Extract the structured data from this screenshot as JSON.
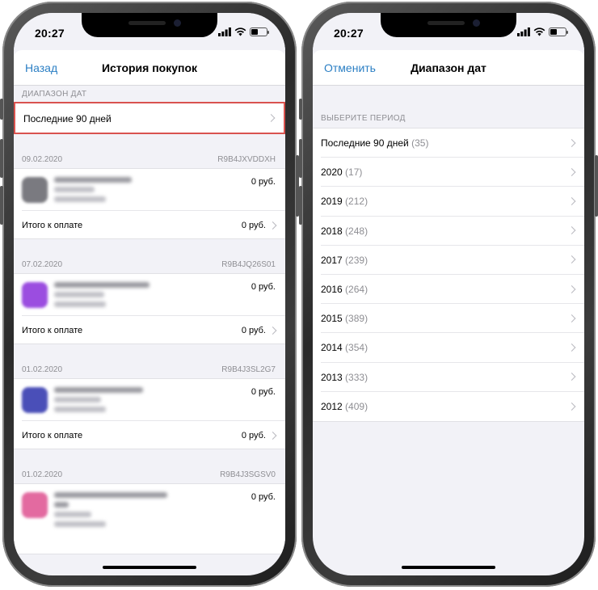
{
  "status": {
    "time": "20:27"
  },
  "left_screen": {
    "nav": {
      "back_label": "Назад",
      "title": "История покупок"
    },
    "range_section_header": "ДИАПАЗОН ДАТ",
    "range_value": "Последние 90 дней",
    "total_label": "Итого к оплате",
    "purchases": [
      {
        "date": "09.02.2020",
        "order_id": "R9B4JXVDDXH",
        "price": "0 руб.",
        "total": "0 руб.",
        "thumb_color": "#7a7a80"
      },
      {
        "date": "07.02.2020",
        "order_id": "R9B4JQ26S01",
        "price": "0 руб.",
        "total": "0 руб.",
        "thumb_color": "#9b4de0"
      },
      {
        "date": "01.02.2020",
        "order_id": "R9B4J3SL2G7",
        "price": "0 руб.",
        "total": "0 руб.",
        "thumb_color": "#4a4fb8"
      },
      {
        "date": "01.02.2020",
        "order_id": "R9B4J3SGSV0",
        "price": "0 руб.",
        "total": "",
        "thumb_color": "#e36aa0"
      }
    ]
  },
  "right_screen": {
    "nav": {
      "cancel_label": "Отменить",
      "title": "Диапазон дат"
    },
    "period_header": "ВЫБЕРИТЕ ПЕРИОД",
    "periods": [
      {
        "label": "Последние 90 дней",
        "count": "(35)"
      },
      {
        "label": "2020",
        "count": "(17)"
      },
      {
        "label": "2019",
        "count": "(212)"
      },
      {
        "label": "2018",
        "count": "(248)"
      },
      {
        "label": "2017",
        "count": "(239)"
      },
      {
        "label": "2016",
        "count": "(264)"
      },
      {
        "label": "2015",
        "count": "(389)"
      },
      {
        "label": "2014",
        "count": "(354)"
      },
      {
        "label": "2013",
        "count": "(333)"
      },
      {
        "label": "2012",
        "count": "(409)"
      }
    ]
  },
  "colors": {
    "accent": "#2b7fc4",
    "highlight": "#d9534f",
    "background": "#f2f2f7"
  }
}
